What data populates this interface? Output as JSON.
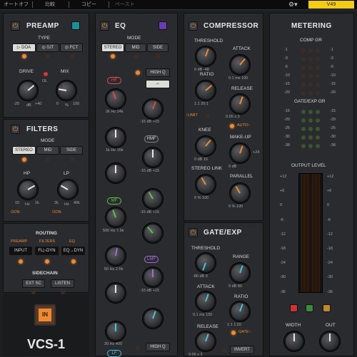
{
  "topbar": {
    "items": [
      "オートオフ",
      "比較",
      "コピー",
      "ペースト"
    ],
    "version": "V49"
  },
  "preamp": {
    "title": "PREAMP",
    "type_label": "TYPE",
    "types": [
      "▷ DOA",
      "◎ 0JT",
      "◎ FCT"
    ],
    "drive_label": "DRIVE",
    "mix_label": "MIX",
    "ol_label": "OL",
    "drive_scale": [
      "-20",
      "dB",
      "+40"
    ],
    "mix_scale": [
      "0",
      "%",
      "100"
    ]
  },
  "filters": {
    "title": "FILTERS",
    "mode_label": "MODE",
    "modes": [
      "STEREO",
      "MID",
      "SIDE"
    ],
    "hp_label": "HP",
    "lp_label": "LP",
    "hp_scale": [
      "10",
      "Hz",
      "1k"
    ],
    "lp_scale": [
      "2k",
      "Hz",
      "40k"
    ],
    "hp_on": "ON",
    "lp_on": "ON"
  },
  "routing": {
    "title": "ROUTING",
    "cols": [
      "PREAMP",
      "FILTERS",
      "EQ"
    ],
    "buttons": [
      "INPUT",
      "FL▷DYN",
      "EQ→DYN"
    ],
    "sidechain_label": "SIDECHAIN",
    "sc_buttons": [
      "EXT SC",
      "LISTEN"
    ]
  },
  "brand": {
    "in_label": "IN",
    "name": "VCS-1"
  },
  "eq": {
    "title": "EQ",
    "mode_label": "MODE",
    "modes": [
      "STEREO",
      "MID",
      "SIDE"
    ],
    "hf": "HF",
    "high_q": "HIGH Q",
    "hmf": "HMF",
    "mf": "MF",
    "lmf": "LMF",
    "lf": "LF",
    "high_q2": "HIGH Q",
    "scales": {
      "freq_hf": [
        "2k",
        "Hz",
        "24k"
      ],
      "gain": [
        "-15",
        "dB",
        "+15"
      ],
      "freq_hmf": [
        "1k",
        "Hz",
        "15k"
      ],
      "freq_mf": [
        "500",
        "Hz",
        "7.5k"
      ],
      "freq_lmf": [
        "50",
        "Hz",
        "2.5k"
      ],
      "freq_lf": [
        "20",
        "Hz",
        "400"
      ]
    }
  },
  "compressor": {
    "title": "COMPRESSOR",
    "threshold": "THRESHOLD",
    "attack": "ATTACK",
    "ratio": "RATIO",
    "release": "RELEASE",
    "limit": "LIMIT",
    "auto": "AUTO",
    "knee": "KNEE",
    "makeup": "MAKE-UP",
    "makeup_val": "+24",
    "stereo_link": "STEREO LINK",
    "parallel": "PARALLEL",
    "scales": {
      "threshold": [
        "0",
        "dB",
        "-48"
      ],
      "attack": [
        "0.1",
        "ms",
        "100"
      ],
      "ratio": [
        "1.1",
        "",
        "20:1"
      ],
      "release": [
        "0.05",
        "s",
        "3"
      ],
      "knee": [
        "0",
        "dB",
        "15"
      ],
      "makeup": [
        "0",
        "dB",
        ""
      ],
      "stereo_link": [
        "0",
        "%",
        "100"
      ],
      "parallel": [
        "0",
        "%",
        "100"
      ]
    }
  },
  "gate": {
    "title": "GATE/EXP",
    "threshold": "THRESHOLD",
    "range": "RANGE",
    "attack": "ATTACK",
    "ratio": "RATIO",
    "release": "RELEASE",
    "gate": "GATE",
    "invert": "INVERT",
    "scales": {
      "threshold": [
        "-80",
        "dB",
        "0"
      ],
      "range": [
        "0",
        "dB",
        "80"
      ],
      "attack": [
        "0.1",
        "ms",
        "100"
      ],
      "ratio": [
        "1:1",
        "",
        "1:20"
      ],
      "release": [
        "0.05",
        "s",
        "3"
      ]
    }
  },
  "metering": {
    "title": "METERING",
    "comp_gr": "COMP GR",
    "gate_gr": "GATE/EXP GR",
    "output_level": "OUTPUT LEVEL",
    "gr_scale": [
      "-1",
      "-3",
      "-6",
      "-10",
      "-15",
      "-20"
    ],
    "gate_scale": [
      "-15",
      "-20",
      "-25",
      "-30",
      "-38"
    ],
    "out_scale": [
      "+12",
      "+6",
      "0",
      "-6",
      "-12",
      "-18",
      "-24",
      "-30",
      "-36"
    ],
    "width": "WIDTH",
    "out": "OUT",
    "colors": {
      "accent": "#f08a30",
      "yellow": "#f2cc18"
    }
  }
}
